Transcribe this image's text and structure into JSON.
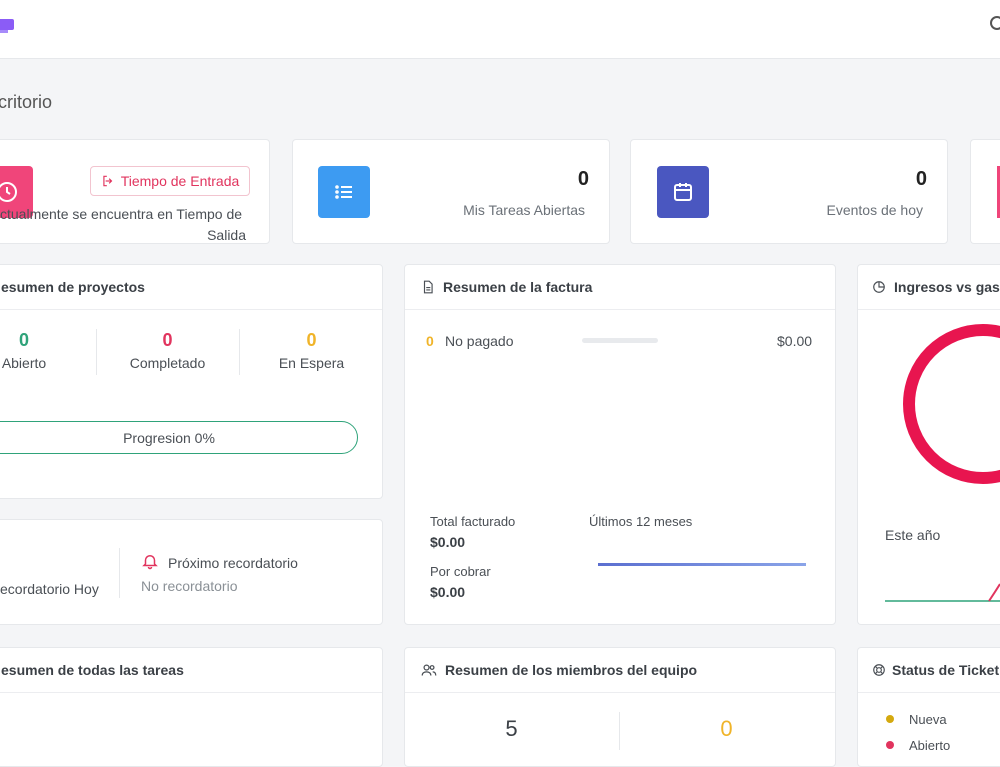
{
  "page": {
    "title": "critorio"
  },
  "cards": {
    "clock": {
      "button_label": "Tiempo de Entrada",
      "status_line1": "ctualmente se encuentra en Tiempo de",
      "status_line2": "Salida"
    },
    "tasks": {
      "count": "0",
      "label": "Mis Tareas Abiertas"
    },
    "events": {
      "count": "0",
      "label": "Eventos de hoy"
    }
  },
  "projects": {
    "title": "esumen de proyectos",
    "stats": [
      {
        "value": "0",
        "label": "Abierto",
        "color": "#2fa37a"
      },
      {
        "value": "0",
        "label": "Completado",
        "color": "#e1345e"
      },
      {
        "value": "0",
        "label": "En Espera",
        "color": "#f0b429"
      }
    ],
    "progress_label": "Progresion 0%"
  },
  "reminders": {
    "today_label": "ecordatorio Hoy",
    "next_title": "Próximo recordatorio",
    "next_value": "No recordatorio"
  },
  "invoice": {
    "title": "Resumen de la factura",
    "unpaid_count": "0",
    "unpaid_label": "No pagado",
    "unpaid_amount": "$0.00",
    "total_label": "Total facturado",
    "total_value": "$0.00",
    "due_label": "Por cobrar",
    "due_value": "$0.00",
    "period_label": "Últimos 12 meses"
  },
  "income": {
    "title": "Ingresos vs gast",
    "year_label": "Este año"
  },
  "all_tasks": {
    "title": "esumen de todas las tareas"
  },
  "team": {
    "title": "Resumen de los miembros del equipo",
    "values": [
      "5",
      "0"
    ]
  },
  "tickets": {
    "title": "Status de Ticket",
    "items": [
      {
        "label": "Nueva",
        "color": "#d4a90f"
      },
      {
        "label": "Abierto",
        "color": "#e1345e"
      }
    ]
  },
  "colors": {
    "accent_pink": "#e1345e",
    "blue": "#3d9bf2",
    "indigo": "#4a57c0",
    "green": "#2fa37a",
    "yellow": "#f0b429"
  }
}
